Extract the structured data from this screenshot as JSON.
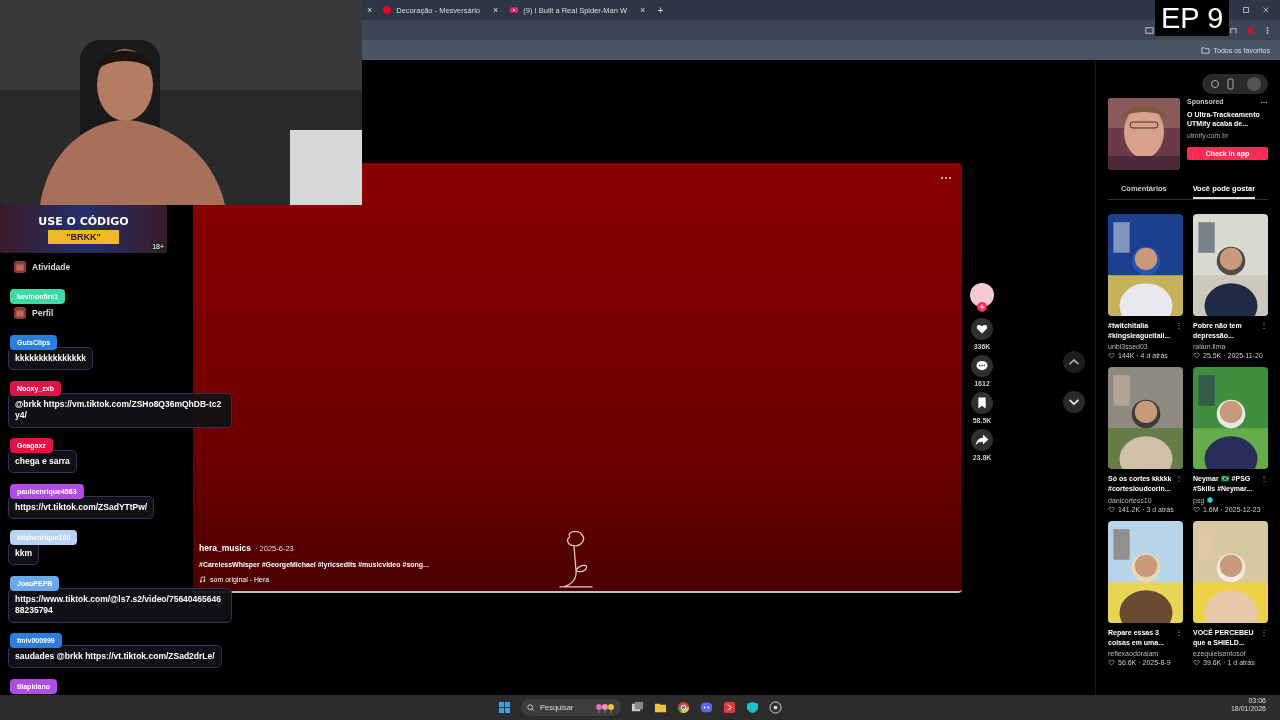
{
  "browser": {
    "prev_tab_close": "×",
    "tabs": [
      {
        "title": "Decoração - Mesversário",
        "kind": "pin",
        "close": "×"
      },
      {
        "title": "(9) I Built a Real Spider-Man W",
        "kind": "video",
        "close": "×"
      }
    ],
    "new_tab": "+",
    "bookmarks": "Todos os favoritos"
  },
  "sidebar": {
    "items": [
      "Atividade",
      "Perfil"
    ]
  },
  "video": {
    "more": "⋯",
    "author": "hera_musics",
    "date": "· 2025-6-23",
    "caption": "#CarelessWhisper #GeorgeMichael #lyricsedits #musicvideo #song...",
    "sound": "som original - Hera"
  },
  "actions": [
    {
      "kind": "like",
      "count": "336K"
    },
    {
      "kind": "comment",
      "count": "1612"
    },
    {
      "kind": "save",
      "count": "58.5K"
    },
    {
      "kind": "share",
      "count": "23.8K"
    }
  ],
  "panel": {
    "ad": {
      "label": "Sponsored",
      "more": "⋯",
      "title": "O Ultra-Trackeamento UTMify acaba de...",
      "domain": "utmify.com.br",
      "button": "Check in app"
    },
    "tabs": [
      {
        "label": "Comentários",
        "selected": false
      },
      {
        "label": "Você pode gostar",
        "selected": true
      }
    ],
    "videos": [
      {
        "title": "#twitchitalia #kingsleagueitali...",
        "menu": "⋮",
        "author": "unbl3ssed03",
        "verified": false,
        "stats": "144K · 4 d atrás"
      },
      {
        "title": "Pobre não tem depressão...",
        "menu": "⋮",
        "author": "raiam.lima",
        "verified": false,
        "stats": "25.5K · 2025-11-20"
      },
      {
        "title": "Só os cortes kkkkk #cortesloudcorin...",
        "menu": "⋮",
        "author": "danicortess10",
        "verified": false,
        "stats": "141.2K · 3 d atrás"
      },
      {
        "title": "Neymar 🇧🇷 #PSG #Skills #Neymar...",
        "menu": "⋮",
        "author": "psg",
        "verified": true,
        "stats": "1.6M · 2025-12-23"
      },
      {
        "title": "Repare essas 3 coisas em uma...",
        "menu": "⋮",
        "author": "reflexaodoraiam",
        "verified": false,
        "stats": "56.6K · 2025-8-9"
      },
      {
        "title": "VOCÊ PERCEBEU que a SHIELD...",
        "menu": "⋮",
        "author": "ezequielsantosof",
        "verified": false,
        "stats": "39.6K · 1 d atrás"
      }
    ]
  },
  "overlay": {
    "episode": "EP 9",
    "promo": {
      "line1": "USE O CÓDIGO",
      "line2": "\"BRKK\"",
      "age": "18+"
    },
    "chat": [
      {
        "user": "kevinonfire1",
        "color": "#3fd9a8"
      },
      {
        "user": "GutsClips",
        "color": "#2a7de1",
        "text": "kkkkkkkkkkkkkkk"
      },
      {
        "user": "Nooxy_zxb",
        "color": "#dc1448",
        "text": "@brkk https://vm.tiktok.com/ZSHo8Q36mQhDB-tc2y4/"
      },
      {
        "user": "Geagaxz",
        "color": "#dc1448",
        "text": "chega e sarra"
      },
      {
        "user": "pauloenrique4563",
        "color": "#b04de8",
        "text": "https://vt.tiktok.com/ZSadYTtPw/"
      },
      {
        "user": "luishenrique100",
        "color": "#b9d3f2",
        "text": "kkm"
      },
      {
        "user": "JoaoPEPB",
        "color": "#6aa8ec",
        "text": "https://www.tiktok.com/@ls7.s2/video/7564046564688235794"
      },
      {
        "user": "fmlv000999",
        "color": "#2a7de1",
        "text": "saudades @brkk https://vt.tiktok.com/ZSad2drLe/"
      },
      {
        "user": "tilapidano",
        "color": "#b04de8"
      }
    ]
  },
  "taskbar": {
    "search": "Pesquisar",
    "time": "03:06",
    "date": "18/01/2026"
  }
}
